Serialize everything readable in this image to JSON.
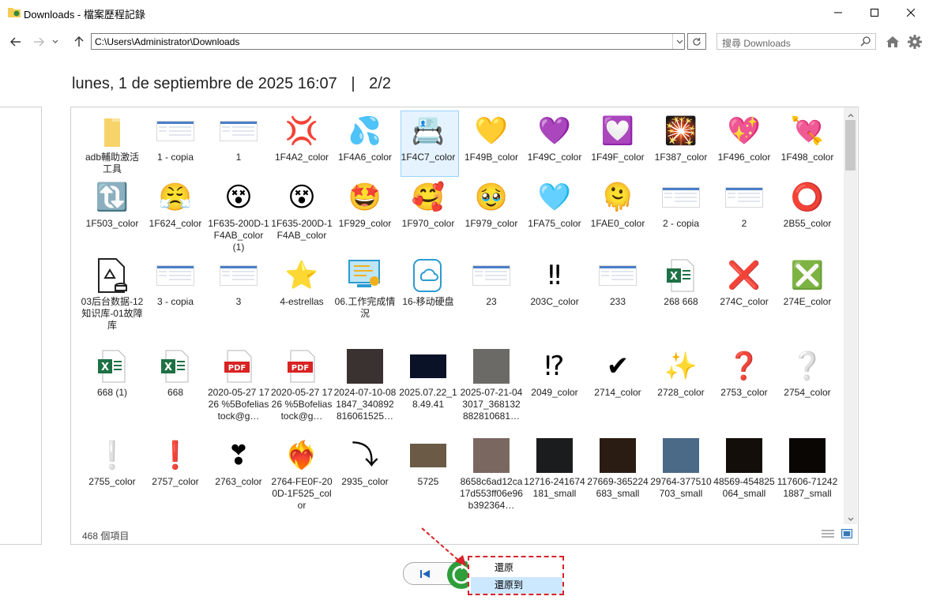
{
  "window": {
    "title": "Downloads - 檔案歷程記錄",
    "minimize": "minimize-icon",
    "maximize": "maximize-icon",
    "close": "close-icon"
  },
  "nav": {
    "back_icon": "arrow-left-icon",
    "forward_icon": "arrow-right-icon",
    "recent_icon": "chevron-down-icon",
    "up_icon": "arrow-up-icon",
    "address": "C:\\Users\\Administrator\\Downloads",
    "search_placeholder": "搜尋 Downloads"
  },
  "header": {
    "date": "lunes, 1 de septiembre de 2025 16:07",
    "separator": "|",
    "page": "2/2"
  },
  "items": [
    {
      "label": "adb輔助激活工具",
      "kind": "folder"
    },
    {
      "label": "1 - copia",
      "kind": "shot"
    },
    {
      "label": "1",
      "kind": "shot"
    },
    {
      "label": "1F4A2_color",
      "kind": "emoji",
      "glyph": "💢"
    },
    {
      "label": "1F4A6_color",
      "kind": "emoji",
      "glyph": "💦"
    },
    {
      "label": "1F4C7_color",
      "kind": "emoji",
      "glyph": "📇",
      "selected": true
    },
    {
      "label": "1F49B_color",
      "kind": "emoji",
      "glyph": "💛"
    },
    {
      "label": "1F49C_color",
      "kind": "emoji",
      "glyph": "💜"
    },
    {
      "label": "1F49F_color",
      "kind": "emoji",
      "glyph": "💟"
    },
    {
      "label": "1F387_color",
      "kind": "emoji",
      "glyph": "🎇"
    },
    {
      "label": "1F496_color",
      "kind": "emoji",
      "glyph": "💖"
    },
    {
      "label": "1F498_color",
      "kind": "emoji",
      "glyph": "💘"
    },
    {
      "label": "1F503_color",
      "kind": "emoji",
      "glyph": "🔃"
    },
    {
      "label": "1F624_color",
      "kind": "emoji",
      "glyph": "😤"
    },
    {
      "label": "1F635-200D-1F4AB_color (1)",
      "kind": "emoji",
      "glyph": "😵"
    },
    {
      "label": "1F635-200D-1F4AB_color",
      "kind": "emoji",
      "glyph": "😵"
    },
    {
      "label": "1F929_color",
      "kind": "emoji",
      "glyph": "🤩"
    },
    {
      "label": "1F970_color",
      "kind": "emoji",
      "glyph": "🥰"
    },
    {
      "label": "1F979_color",
      "kind": "emoji",
      "glyph": "🥹"
    },
    {
      "label": "1FA75_color",
      "kind": "emoji",
      "glyph": "🩵"
    },
    {
      "label": "1FAE0_color",
      "kind": "emoji",
      "glyph": "🫠"
    },
    {
      "label": "2 - copia",
      "kind": "shot"
    },
    {
      "label": "2",
      "kind": "shot"
    },
    {
      "label": "2B55_color",
      "kind": "emoji",
      "glyph": "⭕"
    },
    {
      "label": "03后台数据-12知识库-01故障库",
      "kind": "doc"
    },
    {
      "label": "3 - copia",
      "kind": "shot"
    },
    {
      "label": "3",
      "kind": "shot"
    },
    {
      "label": "4-estrellas",
      "kind": "emoji",
      "glyph": "⭐"
    },
    {
      "label": "06.工作完成情況",
      "kind": "note"
    },
    {
      "label": "16-移动硬盘",
      "kind": "cloud"
    },
    {
      "label": "23",
      "kind": "shot"
    },
    {
      "label": "203C_color",
      "kind": "emoji",
      "glyph": "‼"
    },
    {
      "label": "233",
      "kind": "shot"
    },
    {
      "label": "268 668",
      "kind": "excel"
    },
    {
      "label": "274C_color",
      "kind": "emoji",
      "glyph": "❌"
    },
    {
      "label": "274E_color",
      "kind": "emoji",
      "glyph": "❎"
    },
    {
      "label": "668 (1)",
      "kind": "excel"
    },
    {
      "label": "668",
      "kind": "excel"
    },
    {
      "label": "2020-05-27 1726 %5Bofeliastock@g…",
      "kind": "pdf"
    },
    {
      "label": "2020-05-27 1726 %5Bofeliastock@g…",
      "kind": "pdf"
    },
    {
      "label": "2024-07-10-081847_340892816061525…",
      "kind": "photo",
      "color": "#3a3230"
    },
    {
      "label": "2025.07.22_18.49.41",
      "kind": "photo",
      "color": "#0a1228"
    },
    {
      "label": "2025-07-21-043017_368132882810681…",
      "kind": "photo",
      "color": "#6b6a66"
    },
    {
      "label": "2049_color",
      "kind": "emoji",
      "glyph": "⁉"
    },
    {
      "label": "2714_color",
      "kind": "emoji",
      "glyph": "✔"
    },
    {
      "label": "2728_color",
      "kind": "emoji",
      "glyph": "✨"
    },
    {
      "label": "2753_color",
      "kind": "emoji",
      "glyph": "❓"
    },
    {
      "label": "2754_color",
      "kind": "emoji",
      "glyph": "❔"
    },
    {
      "label": "2755_color",
      "kind": "emoji",
      "glyph": "❕"
    },
    {
      "label": "2757_color",
      "kind": "emoji",
      "glyph": "❗"
    },
    {
      "label": "2763_color",
      "kind": "emoji",
      "glyph": "❣"
    },
    {
      "label": "2764-FE0F-200D-1F525_color",
      "kind": "emoji",
      "glyph": "❤️‍🔥"
    },
    {
      "label": "2935_color",
      "kind": "emoji",
      "glyph": "⤵"
    },
    {
      "label": "5725",
      "kind": "photo",
      "color": "#6a5a46"
    },
    {
      "label": "8658c6ad12ca17d553ff06e96b392364…",
      "kind": "photo",
      "color": "#7a6860"
    },
    {
      "label": "12716-241674181_small",
      "kind": "photo",
      "color": "#1a1c1e"
    },
    {
      "label": "27669-365224683_small",
      "kind": "photo",
      "color": "#2a1c12"
    },
    {
      "label": "29764-377510703_small",
      "kind": "photo",
      "color": "#4a6a88"
    },
    {
      "label": "48569-454825064_small",
      "kind": "photo",
      "color": "#140e0a"
    },
    {
      "label": "117606-712421887_small",
      "kind": "photo",
      "color": "#0a0604"
    }
  ],
  "status": {
    "count": "468 個項目"
  },
  "menu": {
    "restore": "還原",
    "restore_to": "還原到"
  },
  "colors": {
    "accent": "#cce8ff",
    "highlight": "#d8232a",
    "folder": "#f6cc53"
  }
}
